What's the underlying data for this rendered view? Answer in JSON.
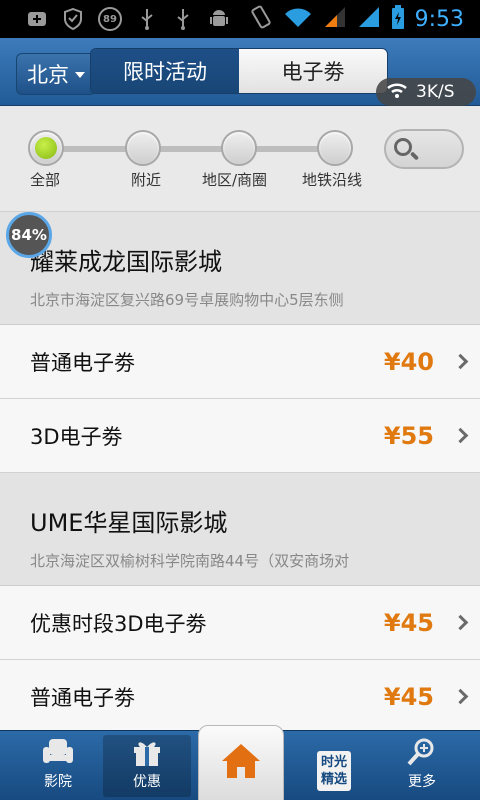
{
  "status_bar": {
    "battery_badge": "89",
    "time": "9:53"
  },
  "header": {
    "city": "北京",
    "tabs": [
      {
        "label": "限时活动",
        "active": true
      },
      {
        "label": "电子劵",
        "active": false
      }
    ],
    "speed": "3K/S"
  },
  "filter": {
    "stops": [
      "全部",
      "附近",
      "地区/商圈",
      "地铁沿线"
    ],
    "selected": "全部"
  },
  "progress": {
    "label": "84%",
    "value": 84
  },
  "list": [
    {
      "cinema": "耀莱成龙国际影城",
      "address": "北京市海淀区复兴路69号卓展购物中心5层东侧",
      "tickets": [
        {
          "name": "普通电子劵",
          "price": "¥40"
        },
        {
          "name": "3D电子劵",
          "price": "¥55"
        }
      ]
    },
    {
      "cinema": "UME华星国际影城",
      "address": "北京海淀区双榆树科学院南路44号（双安商场对",
      "tickets": [
        {
          "name": "优惠时段3D电子劵",
          "price": "¥45"
        },
        {
          "name": "普通电子劵",
          "price": "¥45"
        }
      ]
    }
  ],
  "bottom_nav": {
    "cinema": "影院",
    "deals": "优惠",
    "picks_line1": "时光",
    "picks_line2": "精选",
    "more": "更多"
  },
  "colors": {
    "header_blue": "#2a66a3",
    "price_orange": "#e07a10",
    "status_time_blue": "#3fb0ff",
    "selected_green": "#9ccc1f"
  }
}
